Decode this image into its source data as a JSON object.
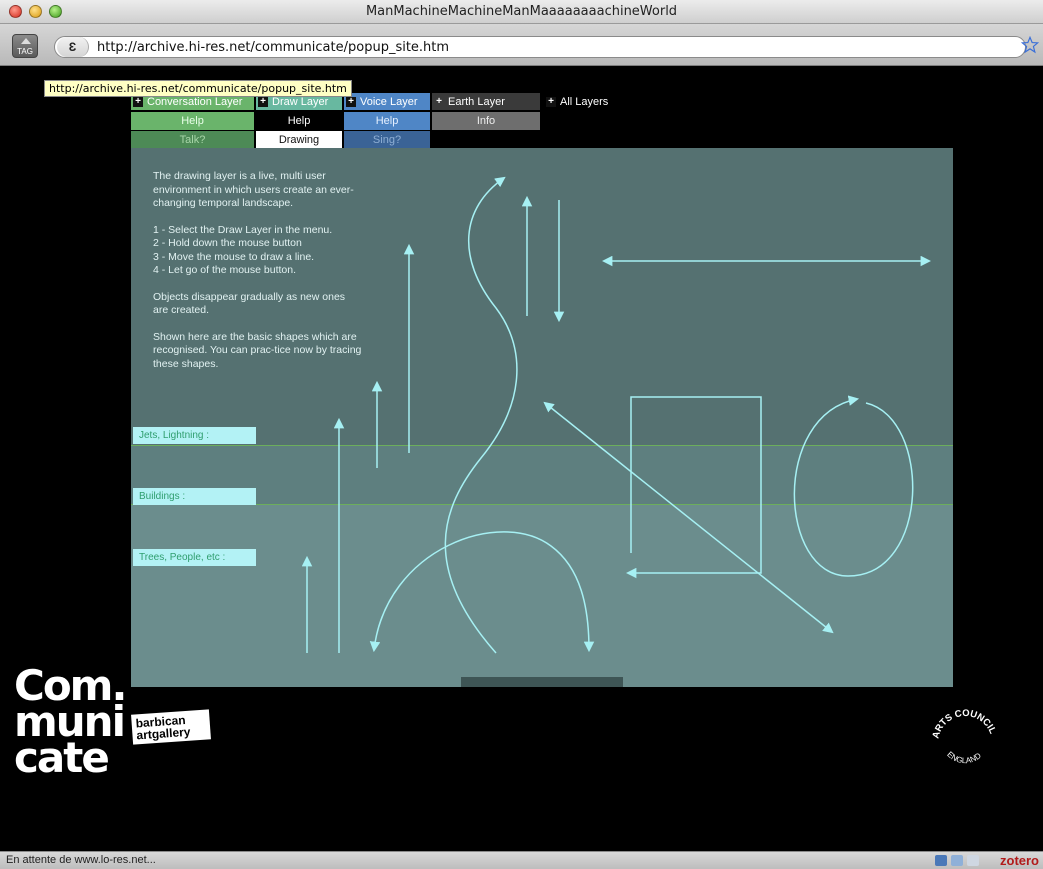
{
  "window": {
    "title": "ManMachineMachineManMaaaaaaaachineWorld"
  },
  "toolbar": {
    "tag_label": "TAG",
    "url": "http://archive.hi-res.net/communicate/popup_site.htm"
  },
  "tooltip": "http://archive.hi-res.net/communicate/popup_site.htm",
  "layers": {
    "conversation": {
      "label": "Conversation Layer",
      "color": "#6ab46b",
      "items": [
        "Help",
        "Talk?"
      ]
    },
    "draw": {
      "label": "Draw Layer",
      "color": "#68b8a0",
      "items": [
        "Help",
        "Drawing"
      ]
    },
    "voice": {
      "label": "Voice Layer",
      "color": "#4f86c6",
      "items": [
        "Help",
        "Sing?"
      ]
    },
    "earth": {
      "label": "Earth Layer",
      "color": "#3a3a3a",
      "items": [
        "Info"
      ]
    },
    "all": {
      "label": "All Layers"
    }
  },
  "stage": {
    "instructions": [
      "The drawing layer is a live, multi user environment in which users create an ever-changing temporal landscape.",
      "1 - Select the Draw Layer in the menu.\n2 - Hold down the mouse button\n3 - Move the mouse to draw a line.\n4 - Let go of the mouse button.",
      "Objects disappear gradually as new ones are created.",
      "Shown here are the basic shapes which are recognised. You can prac-tice now by tracing these shapes."
    ],
    "zones": [
      "Jets, Lightning :",
      "Buildings :",
      "Trees, People, etc :"
    ]
  },
  "logos": {
    "communicate_lines": [
      "Com.",
      "muni",
      "cate"
    ],
    "barbican_lines": [
      "barbican",
      "artgallery"
    ],
    "arts_council_top": "ARTS COUNCIL",
    "arts_council_bottom": "ENGLAND"
  },
  "statusbar": {
    "text": "En attente de www.lo-res.net...",
    "zotero": "zotero"
  },
  "colors": {
    "shape_stroke": "#a6f0f3",
    "zone_label_bg": "#b3f2f5"
  }
}
